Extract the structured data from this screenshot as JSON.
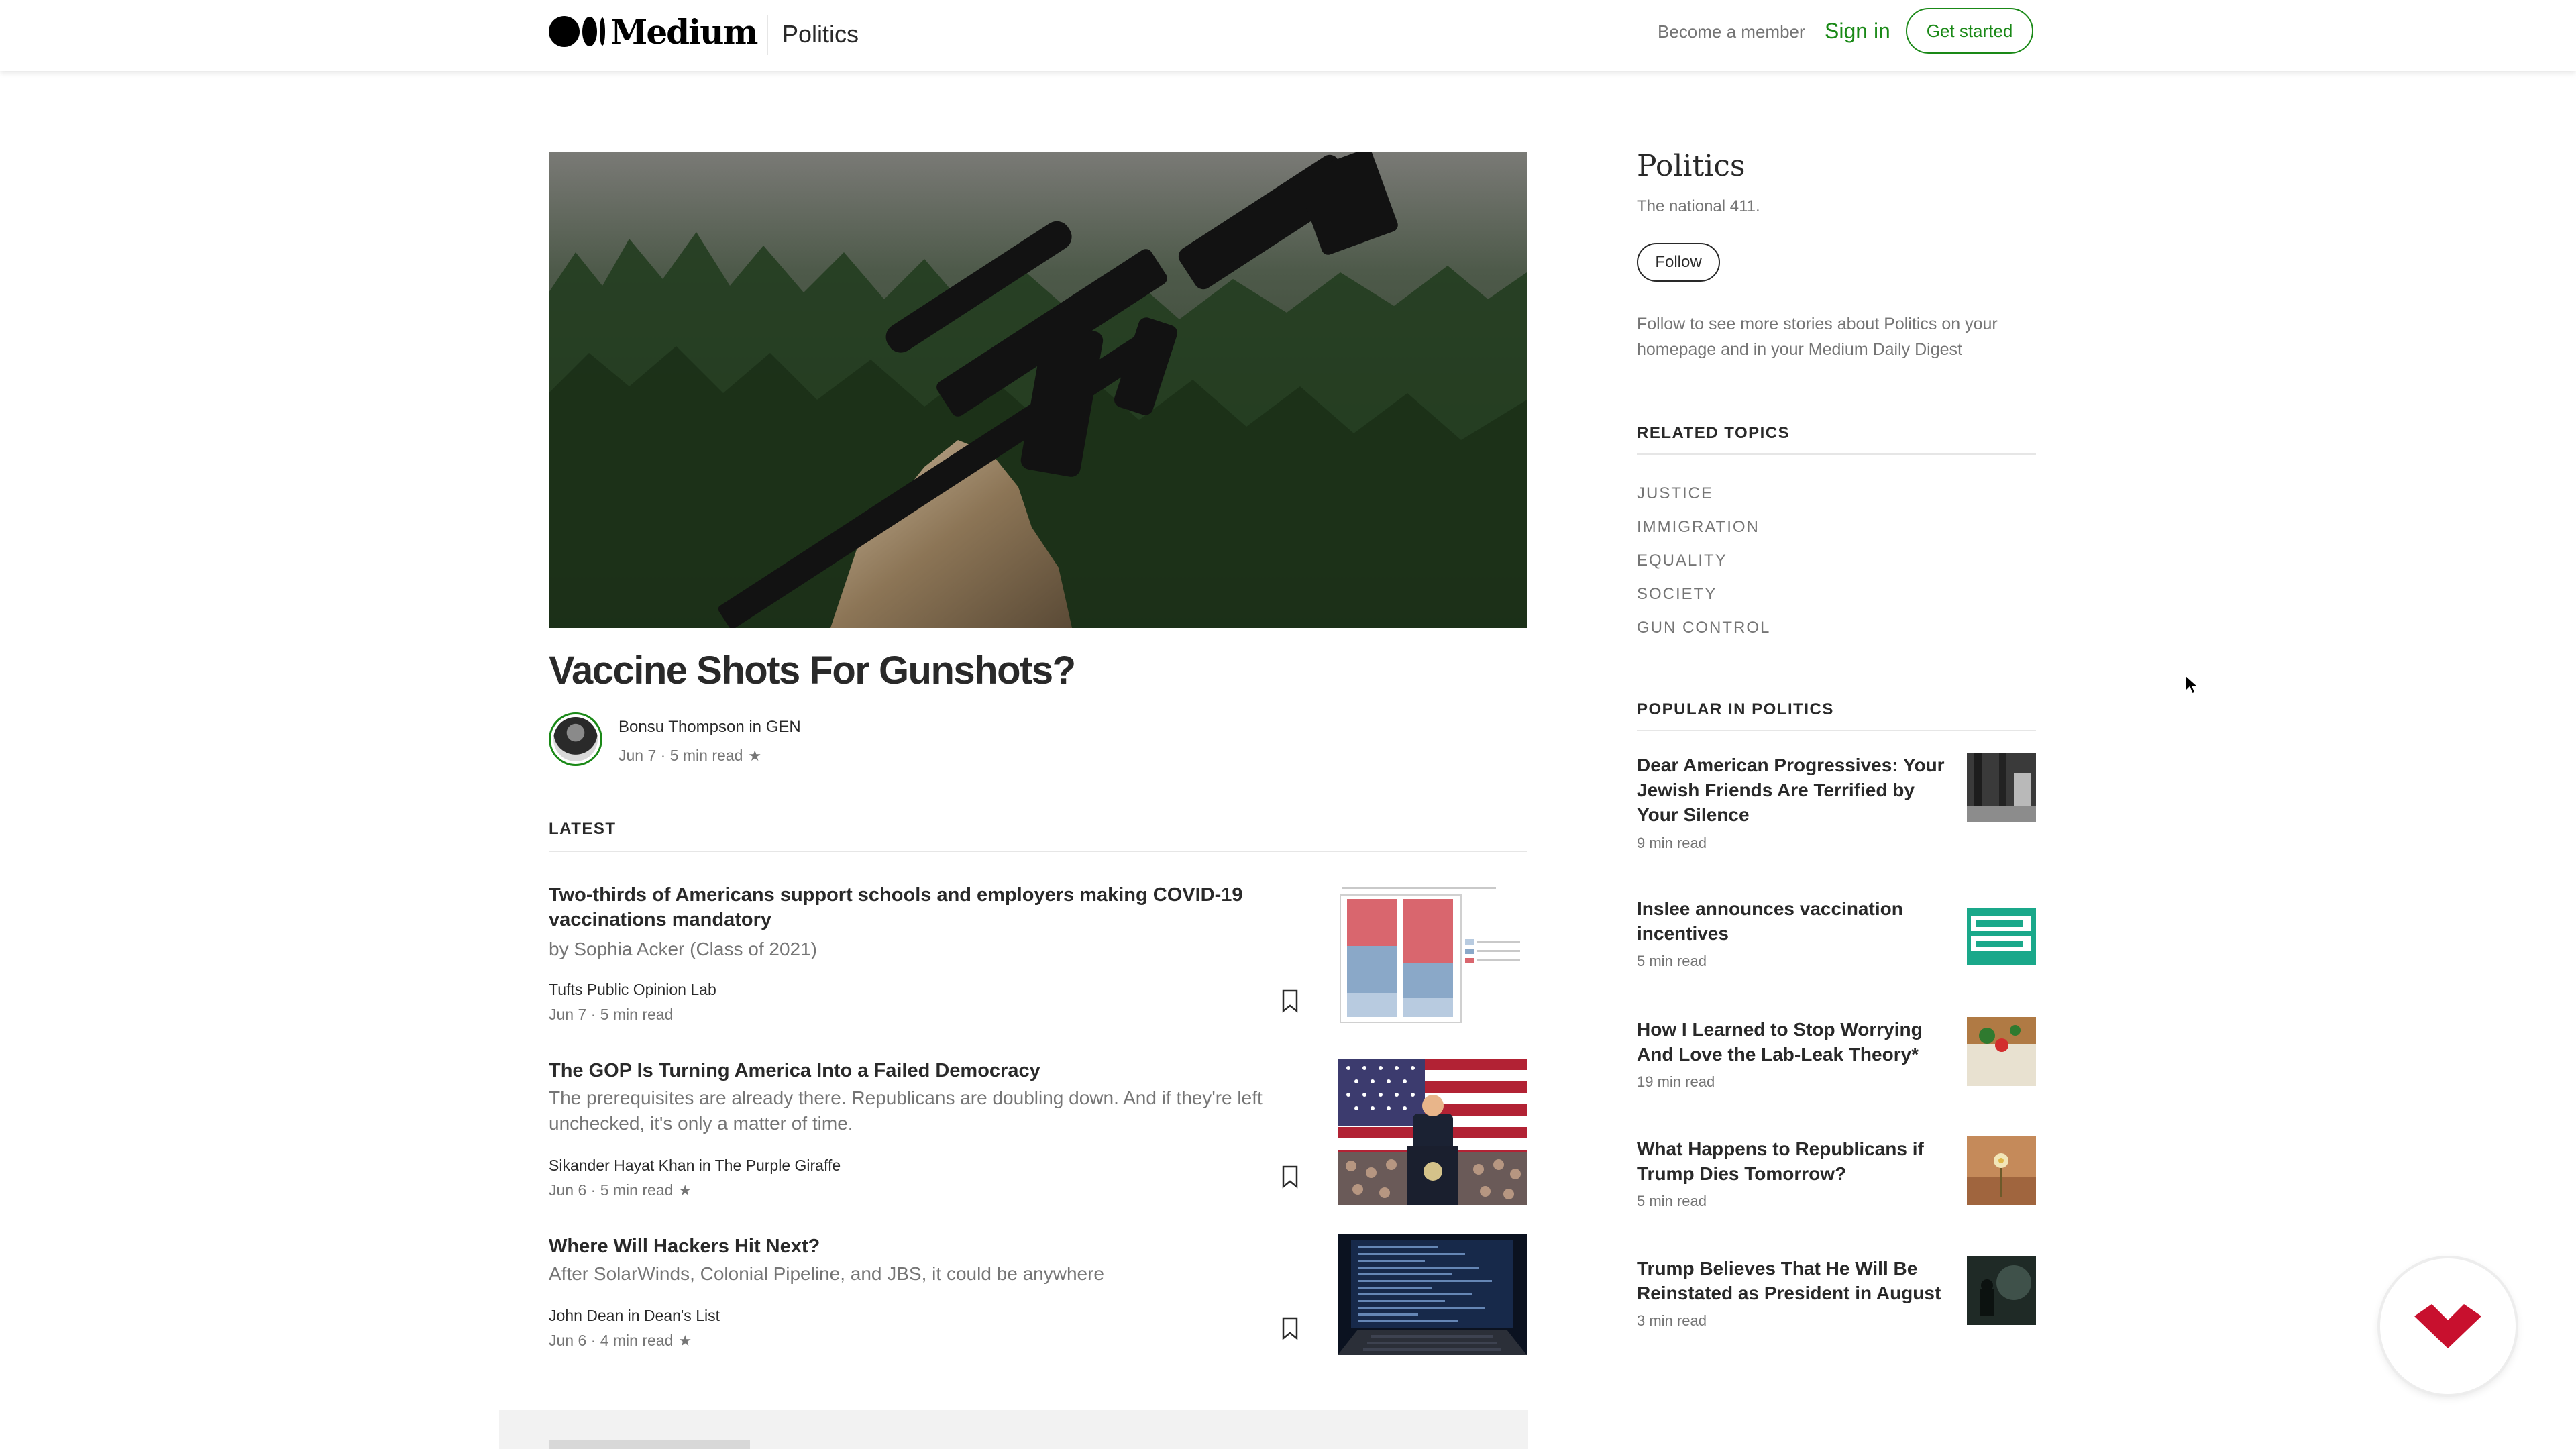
{
  "header": {
    "logo_text": "Medium",
    "topic": "Politics",
    "become_member": "Become a member",
    "sign_in": "Sign in",
    "get_started": "Get started"
  },
  "hero": {
    "title": "Vaccine Shots For Gunshots?",
    "author": "Bonsu Thompson in GEN",
    "date": "Jun 7",
    "read_time": "5 min read",
    "member_star": "★"
  },
  "latest": {
    "label": "LATEST",
    "articles": [
      {
        "title": "Two-thirds of Americans support schools and employers making COVID-19 vaccinations mandatory",
        "subtitle": "by Sophia Acker (Class of 2021)",
        "author": "Tufts Public Opinion Lab",
        "meta": "Jun 7 · 5 min read",
        "thumb": "chart-thumbnail"
      },
      {
        "title": "The GOP Is Turning America Into a Failed Democracy",
        "subtitle": "The prerequisites are already there. Republicans are doubling down. And if they're left unchecked, it's only a matter of time.",
        "author": "Sikander Hayat Khan in The Purple Giraffe",
        "meta": "Jun 6 · 5 min read",
        "star": "★",
        "thumb": "rally-thumbnail"
      },
      {
        "title": "Where Will Hackers Hit Next?",
        "subtitle": "After SolarWinds, Colonial Pipeline, and JBS, it could be anywhere",
        "author": "John Dean in Dean's List",
        "meta": "Jun 6 · 4 min read",
        "star": "★",
        "thumb": "laptop-thumbnail"
      }
    ]
  },
  "sidebar": {
    "title": "Politics",
    "tagline": "The national 411.",
    "follow": "Follow",
    "follow_desc": "Follow to see more stories about Politics on your homepage and in your Medium Daily Digest",
    "related_label": "RELATED TOPICS",
    "related_topics": [
      "JUSTICE",
      "IMMIGRATION",
      "EQUALITY",
      "SOCIETY",
      "GUN CONTROL"
    ],
    "popular_label": "POPULAR IN POLITICS",
    "popular": [
      {
        "title": "Dear American Progressives: Your Jewish Friends Are Terrified by Your Silence",
        "read": "9 min read"
      },
      {
        "title": "Inslee announces vaccination incentives",
        "read": "5 min read"
      },
      {
        "title": "How I Learned to Stop Worrying And Love the Lab-Leak Theory*",
        "read": "19 min read"
      },
      {
        "title": "What Happens to Republicans if Trump Dies Tomorrow?",
        "read": "5 min read"
      },
      {
        "title": "Trump Believes That He Will Be Reinstated as President in August",
        "read": "3 min read"
      }
    ]
  },
  "colors": {
    "accent_green": "#1a8917",
    "text": "#292929",
    "muted": "#757575",
    "fab_red": "#c8102e"
  }
}
